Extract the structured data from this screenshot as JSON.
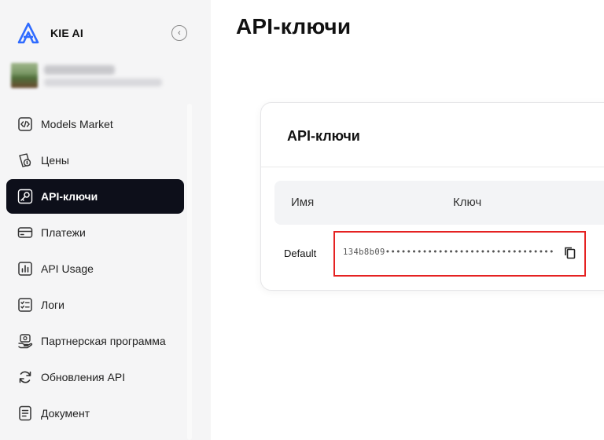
{
  "brand": {
    "name": "KIE AI",
    "collapse_icon": "chevron-left-icon"
  },
  "sidebar": {
    "items": [
      {
        "label": "Models Market",
        "icon": "code-icon",
        "active": false
      },
      {
        "label": "Цены",
        "icon": "pricing-icon",
        "active": false
      },
      {
        "label": "API-ключи",
        "icon": "key-icon",
        "active": true
      },
      {
        "label": "Платежи",
        "icon": "credit-card-icon",
        "active": false
      },
      {
        "label": "API Usage",
        "icon": "bar-chart-icon",
        "active": false
      },
      {
        "label": "Логи",
        "icon": "logs-icon",
        "active": false
      },
      {
        "label": "Партнерская программа",
        "icon": "partner-icon",
        "active": false
      },
      {
        "label": "Обновления API",
        "icon": "refresh-icon",
        "active": false
      },
      {
        "label": "Документ",
        "icon": "document-icon",
        "active": false
      }
    ]
  },
  "page": {
    "title": "API-ключи"
  },
  "card": {
    "title": "API-ключи",
    "columns": {
      "name": "Имя",
      "key": "Ключ"
    },
    "rows": [
      {
        "name": "Default",
        "key": "134b8b09••••••••••••••••••••••••••••••••"
      }
    ]
  },
  "colors": {
    "active_nav_bg": "#0d0f1a",
    "highlight_border": "#e52222",
    "sidebar_bg": "#f5f5f6",
    "brand_logo": "#2f6bff"
  }
}
